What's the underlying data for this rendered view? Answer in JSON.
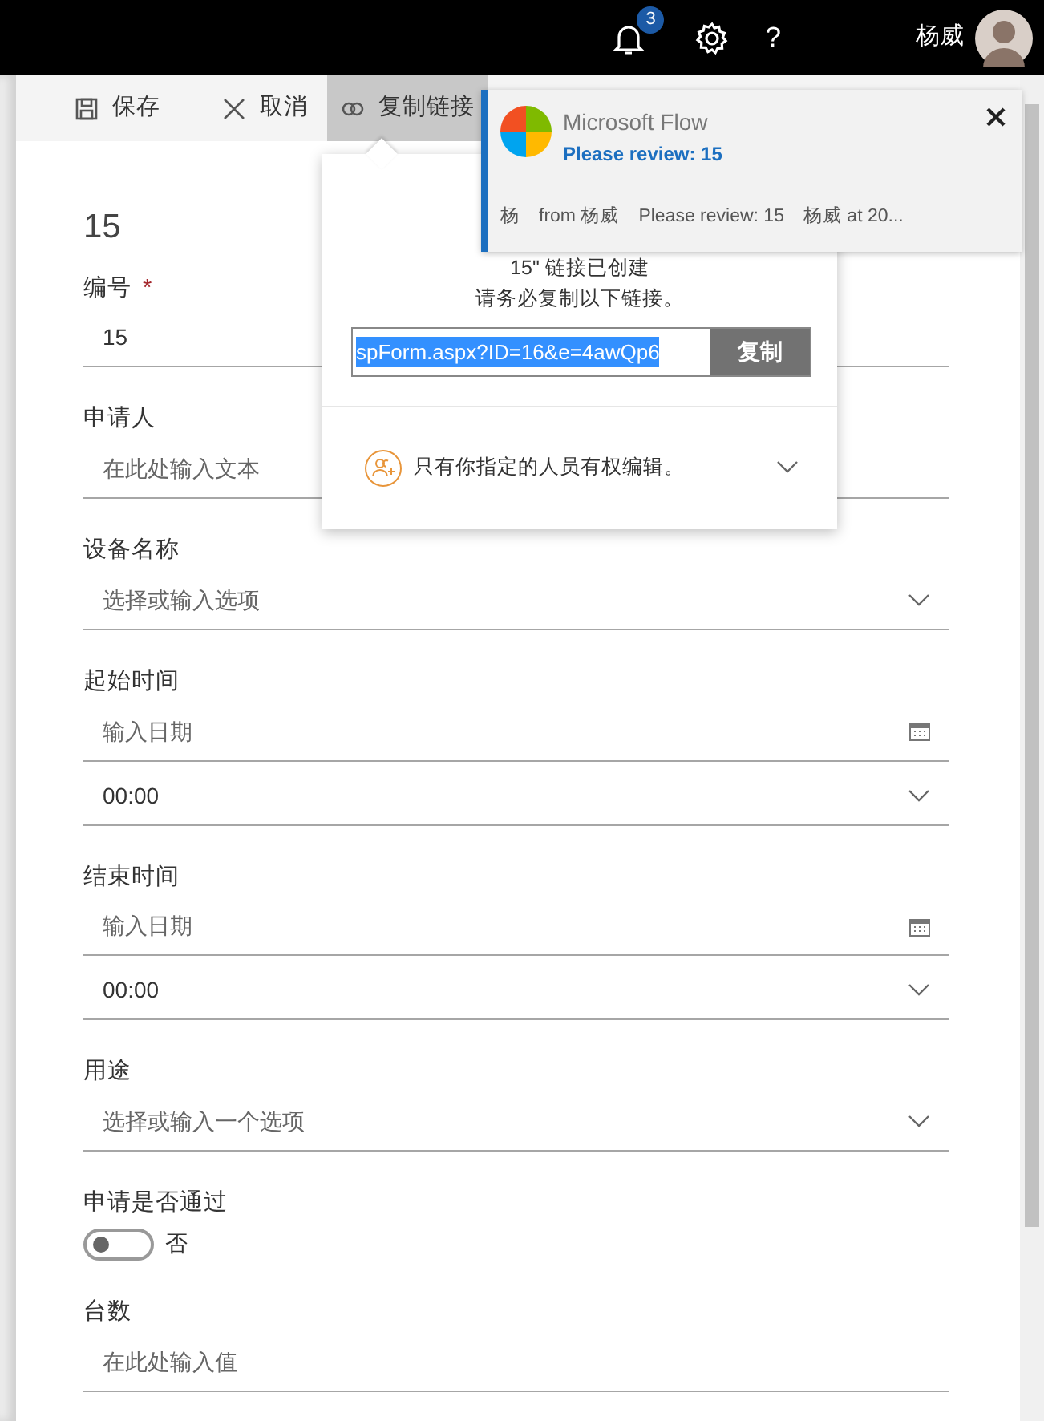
{
  "top_bar": {
    "notification_count": "3",
    "help": "?",
    "user_name": "杨威"
  },
  "command_bar": [
    {
      "kind": "save",
      "label": "保存",
      "selected": false
    },
    {
      "kind": "cancel",
      "label": "取消",
      "selected": false
    },
    {
      "kind": "link",
      "label": "复制链接",
      "selected": true
    }
  ],
  "form": {
    "title": "15",
    "fields": [
      {
        "kind": "text",
        "label": "编号",
        "required": true,
        "required_mark": "*",
        "value": "15"
      },
      {
        "kind": "text",
        "label": "申请人",
        "required": false,
        "placeholder": "在此处输入文本"
      },
      {
        "kind": "dropdown",
        "label": "设备名称",
        "required": false,
        "placeholder": "选择或输入选项"
      },
      {
        "kind": "datetime",
        "label": "起始时间",
        "required": false,
        "placeholder": "输入日期",
        "time": "00:00"
      },
      {
        "kind": "datetime",
        "label": "结束时间",
        "required": false,
        "placeholder": "输入日期",
        "time": "00:00"
      },
      {
        "kind": "dropdown",
        "label": "用途",
        "required": false,
        "placeholder": "选择或输入一个选项"
      },
      {
        "kind": "toggle",
        "label": "申请是否通过",
        "required": false,
        "on": false,
        "state_text": "否"
      },
      {
        "kind": "text",
        "label": "台数",
        "required": false,
        "placeholder": "在此处输入值"
      }
    ]
  },
  "share_popover": {
    "created_text": "15\" 链接已创建",
    "instruction": "请务必复制以下链接。",
    "link": {
      "value": "spForm.aspx?ID=16&e=4awQp6",
      "selected": true
    },
    "copy_button": "复制",
    "permission": "只有你指定的人员有权编辑。"
  },
  "notification": {
    "app": "Microsoft Flow",
    "subject": "Please review: 15",
    "details": [
      "杨",
      "from 杨威",
      "Please review: 15",
      "杨威 at 20..."
    ]
  }
}
